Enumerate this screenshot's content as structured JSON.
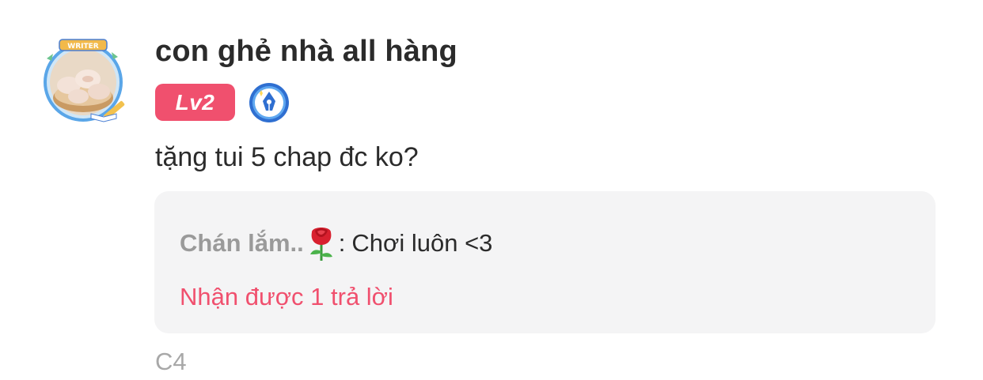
{
  "comment": {
    "avatar": {
      "icon": "writer-avatar",
      "frame_label": "WRITER"
    },
    "username": "con ghẻ nhà all hàng",
    "level_badge": "Lv2",
    "writer_badge_icon": "pen-nib-icon",
    "text": "tặng tui 5 chap đc ko?",
    "reply_preview": {
      "author": "Chán lắm..",
      "author_emoji_icon": "rose-icon",
      "separator": ":",
      "content": "Chơi luôn <3"
    },
    "reply_count_text": "Nhận được 1 trả lời",
    "chapter": "C4"
  },
  "colors": {
    "accent": "#f0506e",
    "username": "#2b2b2b",
    "muted": "#9a9a9a",
    "reply_bg": "#f4f4f5",
    "badge_blue": "#3c86e0"
  }
}
